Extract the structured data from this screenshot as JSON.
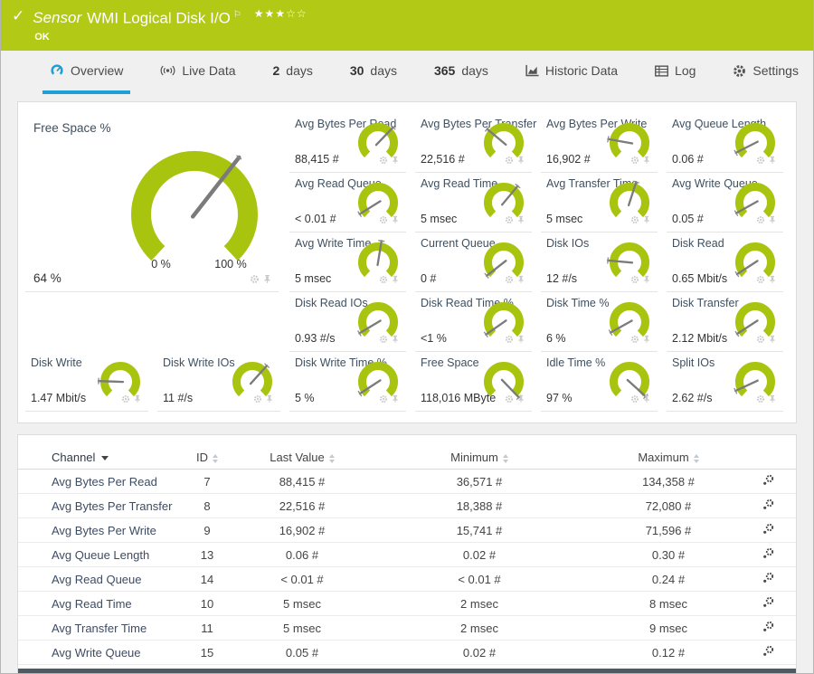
{
  "colors": {
    "header_green": "#b2ca16",
    "gauge_olive": "#a9c40e",
    "accent_blue": "#1d9fd9",
    "needle_gray": "#7b7b7b"
  },
  "header": {
    "kind": "Sensor",
    "title": "WMI Logical Disk I/O",
    "status": "OK",
    "rating": {
      "filled": 3,
      "total": 5
    },
    "icons": [
      "check-icon",
      "flag-icon"
    ]
  },
  "tabs": [
    {
      "icon": "gauge-icon",
      "label": "Overview",
      "active": true
    },
    {
      "icon": "live-data-icon",
      "label": "Live Data"
    },
    {
      "strong": "2",
      "label": "days"
    },
    {
      "strong": "30",
      "label": "days"
    },
    {
      "strong": "365",
      "label": "days"
    },
    {
      "icon": "historic-data-icon",
      "label": "Historic Data"
    },
    {
      "icon": "log-icon",
      "label": "Log"
    },
    {
      "icon": "settings-icon",
      "label": "Settings"
    }
  ],
  "gauges": {
    "big": {
      "label": "Free Space %",
      "value": "64 %",
      "scale_min": "0 %",
      "scale_max": "100 %",
      "needle_deg": 38
    },
    "grid": [
      {
        "label": "Avg Bytes Per Read",
        "value": "88,415 #",
        "needle_deg": 44
      },
      {
        "label": "Avg Bytes Per Transfer",
        "value": "22,516 #",
        "needle_deg": -50
      },
      {
        "label": "Avg Bytes Per Write",
        "value": "16,902 #",
        "needle_deg": -80
      },
      {
        "label": "Avg Queue Length",
        "value": "0.06 #",
        "needle_deg": -117
      },
      {
        "label": "Avg Read Queue",
        "value": "< 0.01 #",
        "needle_deg": -122
      },
      {
        "label": "Avg Read Time",
        "value": "5 msec",
        "needle_deg": 40
      },
      {
        "label": "Avg Transfer Time",
        "value": "5 msec",
        "needle_deg": 18
      },
      {
        "label": "Avg Write Queue",
        "value": "0.05 #",
        "needle_deg": -119
      },
      {
        "label": "Avg Write Time",
        "value": "5 msec",
        "needle_deg": 9
      },
      {
        "label": "Current Queue",
        "value": "0 #",
        "needle_deg": -128
      },
      {
        "label": "Disk IOs",
        "value": "12 #/s",
        "needle_deg": -85
      },
      {
        "label": "Disk Read",
        "value": "0.65 Mbit/s",
        "needle_deg": -123
      },
      {
        "label": "Disk Read IOs",
        "value": "0.93 #/s",
        "needle_deg": -121
      },
      {
        "label": "Disk Read Time %",
        "value": "<1 %",
        "needle_deg": -125
      },
      {
        "label": "Disk Time %",
        "value": "6 %",
        "needle_deg": -119
      },
      {
        "label": "Disk Transfer",
        "value": "2.12 Mbit/s",
        "needle_deg": -123
      },
      {
        "label": "Disk Write Time %",
        "value": "5 %",
        "needle_deg": -123
      },
      {
        "label": "Free Space",
        "value": "118,016 MByte",
        "needle_deg": 136
      },
      {
        "label": "Idle Time %",
        "value": "97 %",
        "needle_deg": 132
      },
      {
        "label": "Split IOs",
        "value": "2.62 #/s",
        "needle_deg": -115
      }
    ],
    "bottom_left": [
      {
        "label": "Disk Write",
        "value": "1.47 Mbit/s",
        "needle_deg": -88
      },
      {
        "label": "Disk Write IOs",
        "value": "11 #/s",
        "needle_deg": 42
      }
    ],
    "cell_icons": [
      "gear-icon",
      "pin-icon"
    ]
  },
  "table": {
    "columns": [
      {
        "label": "Channel",
        "sort": "desc"
      },
      {
        "label": "ID",
        "sort": "both"
      },
      {
        "label": "Last Value",
        "sort": "both"
      },
      {
        "label": "Minimum",
        "sort": "both"
      },
      {
        "label": "Maximum",
        "sort": "both"
      }
    ],
    "rows": [
      {
        "channel": "Avg Bytes Per Read",
        "id": "7",
        "last": "88,415 #",
        "min": "36,571 #",
        "max": "134,358 #"
      },
      {
        "channel": "Avg Bytes Per Transfer",
        "id": "8",
        "last": "22,516 #",
        "min": "18,388 #",
        "max": "72,080 #"
      },
      {
        "channel": "Avg Bytes Per Write",
        "id": "9",
        "last": "16,902 #",
        "min": "15,741 #",
        "max": "71,596 #"
      },
      {
        "channel": "Avg Queue Length",
        "id": "13",
        "last": "0.06 #",
        "min": "0.02 #",
        "max": "0.30 #"
      },
      {
        "channel": "Avg Read Queue",
        "id": "14",
        "last": "< 0.01 #",
        "min": "< 0.01 #",
        "max": "0.24 #"
      },
      {
        "channel": "Avg Read Time",
        "id": "10",
        "last": "5 msec",
        "min": "2 msec",
        "max": "8 msec"
      },
      {
        "channel": "Avg Transfer Time",
        "id": "11",
        "last": "5 msec",
        "min": "2 msec",
        "max": "9 msec"
      },
      {
        "channel": "Avg Write Queue",
        "id": "15",
        "last": "0.05 #",
        "min": "0.02 #",
        "max": "0.12 #"
      }
    ],
    "row_action_icon": "channel-settings-gear-icon"
  }
}
